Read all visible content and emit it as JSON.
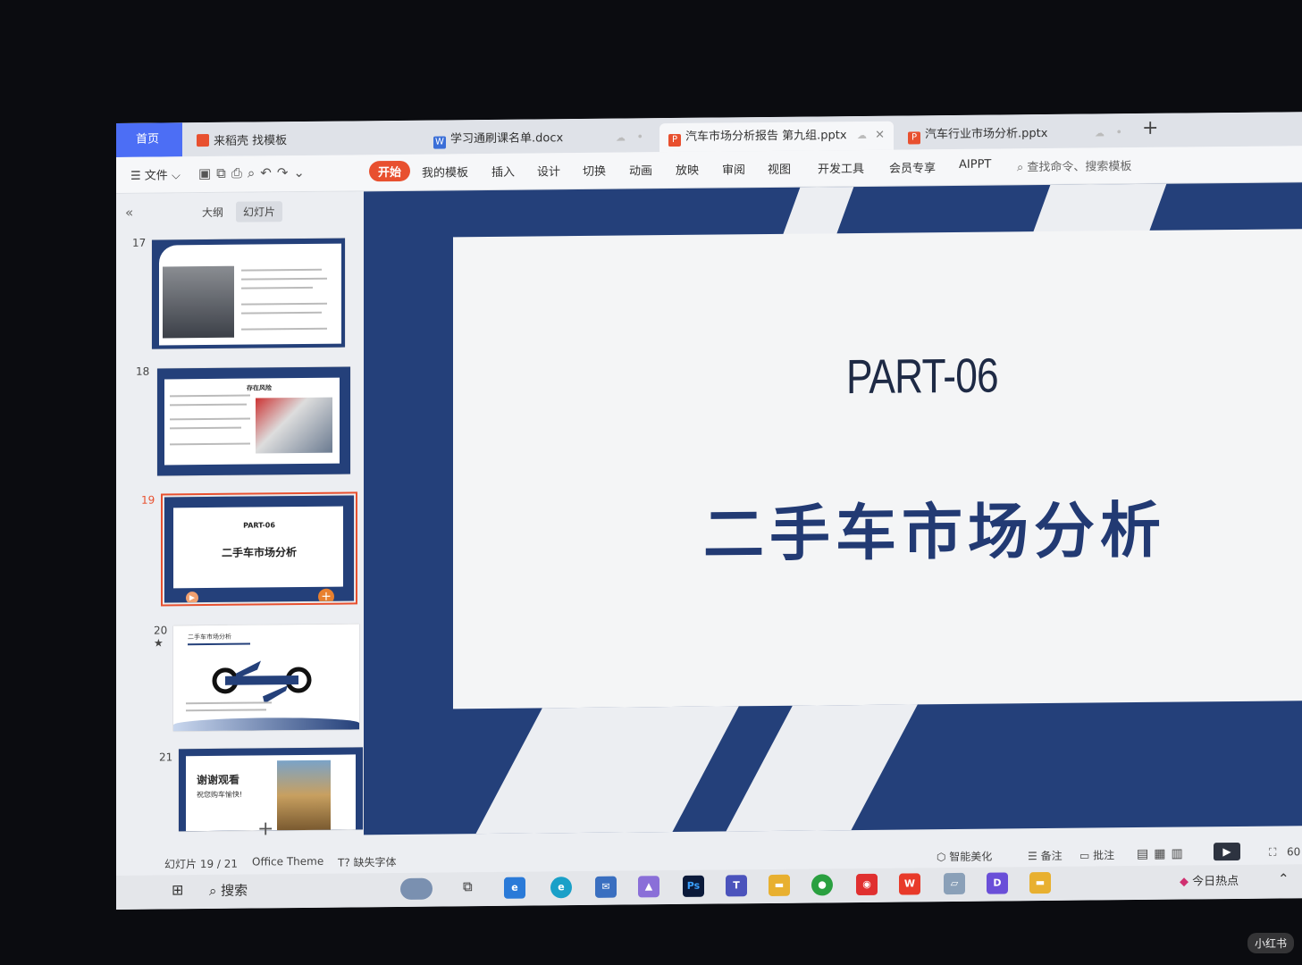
{
  "tabs": {
    "home": "首页",
    "templates": "来稻壳 找模板",
    "doc": "学习通刷课名单.docx",
    "active_ppt": "汽车市场分析报告 第九组.pptx",
    "ppt2": "汽车行业市场分析.pptx"
  },
  "ribbon": {
    "file": "文件",
    "items": [
      "开始",
      "我的模板",
      "插入",
      "设计",
      "切换",
      "动画",
      "放映",
      "审阅",
      "视图",
      "开发工具",
      "会员专享",
      "AIPPT"
    ],
    "search_placeholder": "查找命令、搜索模板"
  },
  "panel": {
    "outline_tab": "大纲",
    "slides_tab": "幻灯片",
    "slides": [
      {
        "num": "17"
      },
      {
        "num": "18",
        "heading": "存在风险"
      },
      {
        "num": "19",
        "part": "PART-06",
        "title": "二手车市场分析"
      },
      {
        "num": "20",
        "title": "二手车市场分析"
      },
      {
        "num": "21",
        "title": "谢谢观看",
        "subtitle": "祝您购车愉快!"
      }
    ]
  },
  "slide": {
    "part": "PART-06",
    "title": "二手车市场分析"
  },
  "status": {
    "slide_counter": "幻灯片 19 / 21",
    "theme": "Office Theme",
    "missing_font": "缺失字体",
    "beautify": "智能美化",
    "notes": "备注",
    "comments": "批注",
    "zoom": "60"
  },
  "taskbar": {
    "search": "搜索",
    "today": "今日热点"
  },
  "watermark": "小红书",
  "colors": {
    "accent": "#e8502f",
    "navy": "#24407a",
    "home_tab": "#4c6ef5"
  }
}
